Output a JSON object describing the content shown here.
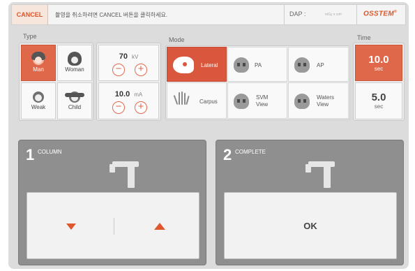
{
  "topbar": {
    "cancel_label": "CANCEL",
    "notice": "촬영을 취소하려면 CANCEL 버튼을 클릭하세요.",
    "dap_label": "DAP :",
    "dap_unit": "mGy x cm²",
    "brand": "OSSTEM",
    "brand_mark": "®"
  },
  "type": {
    "label": "Type",
    "items": [
      {
        "label": "Man",
        "icon": "man-icon",
        "active": true
      },
      {
        "label": "Woman",
        "icon": "woman-icon",
        "active": false
      },
      {
        "label": "Weak",
        "icon": "weak-icon",
        "active": false
      },
      {
        "label": "Child",
        "icon": "child-icon",
        "active": false
      }
    ]
  },
  "exposure": {
    "kv": {
      "value": "70",
      "unit": "kV"
    },
    "ma": {
      "value": "10.0",
      "unit": "mA"
    },
    "minus_symbol": "−",
    "plus_symbol": "+"
  },
  "mode": {
    "label": "Mode",
    "items": [
      {
        "label": "Lateral",
        "active": true
      },
      {
        "label": "PA",
        "active": false
      },
      {
        "label": "AP",
        "active": false
      },
      {
        "label": "Carpus",
        "active": false
      },
      {
        "label_line1": "SVM",
        "label_line2": "View",
        "active": false
      },
      {
        "label_line1": "Waters",
        "label_line2": "View",
        "active": false
      }
    ]
  },
  "time": {
    "label": "Time",
    "options": [
      {
        "value": "10.0",
        "unit": "sec",
        "active": true
      },
      {
        "value": "5.0",
        "unit": "sec",
        "active": false
      }
    ]
  },
  "steps": [
    {
      "number": "1",
      "label": "COLUMN"
    },
    {
      "number": "2",
      "label": "COMPLETE",
      "button_label": "OK"
    }
  ],
  "colors": {
    "accent": "#e0684a",
    "arrow": "#e0572e",
    "panel_dark": "#8f8f8f"
  }
}
